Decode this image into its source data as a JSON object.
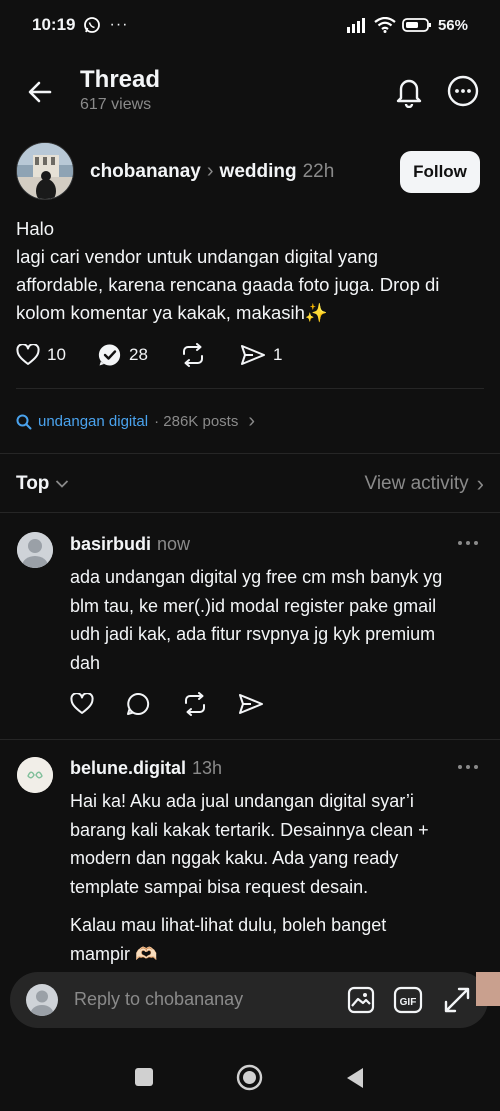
{
  "status": {
    "time": "10:19",
    "battery": "56%"
  },
  "header": {
    "title": "Thread",
    "views": "617 views"
  },
  "post": {
    "author": "chobananay",
    "topic": "wedding",
    "time": "22h",
    "follow_label": "Follow",
    "lines": [
      "Halo",
      "lagi cari vendor untuk undangan digital yang",
      "affordable, karena rencana gaada foto juga. Drop di",
      "kolom komentar ya kakak, makasih✨"
    ],
    "likes": "10",
    "replies": "28",
    "shares": "1"
  },
  "tag": {
    "label": "undangan digital",
    "meta": "· 286K posts"
  },
  "sort": {
    "label": "Top",
    "view_activity": "View activity"
  },
  "comments": [
    {
      "author": "basirbudi",
      "time": "now",
      "paragraphs": [
        [
          "ada undangan digital yg free cm msh banyk yg",
          "blm tau, ke mer(.)id modal register pake gmail",
          "udh jadi kak, ada fitur rsvpnya jg kyk premium",
          "dah"
        ]
      ]
    },
    {
      "author": "belune.digital",
      "time": "13h",
      "paragraphs": [
        [
          "Hai ka! Aku ada jual undangan digital syar’i",
          "barang kali kakak tertarik. Desainnya clean +",
          "modern dan nggak kaku. Ada yang ready",
          "template sampai bisa request desain."
        ],
        [
          "Kalau mau lihat-lihat dulu, boleh banget",
          "mampir 🫶🏻"
        ]
      ]
    }
  ],
  "reply": {
    "placeholder": "Reply to chobananay"
  },
  "icons": {
    "back": "arrow-left-icon",
    "bell": "bell-icon",
    "more": "more-circle-icon",
    "heart": "heart-icon",
    "verified_reply": "verified-reply-icon",
    "repost": "repost-icon",
    "share": "share-icon",
    "search": "search-icon",
    "gif": "gif-icon",
    "image": "image-icon",
    "expand": "expand-icon"
  },
  "colors": {
    "background": "#101010",
    "accent": "#4aa3ee",
    "muted": "#8a8a8a"
  }
}
